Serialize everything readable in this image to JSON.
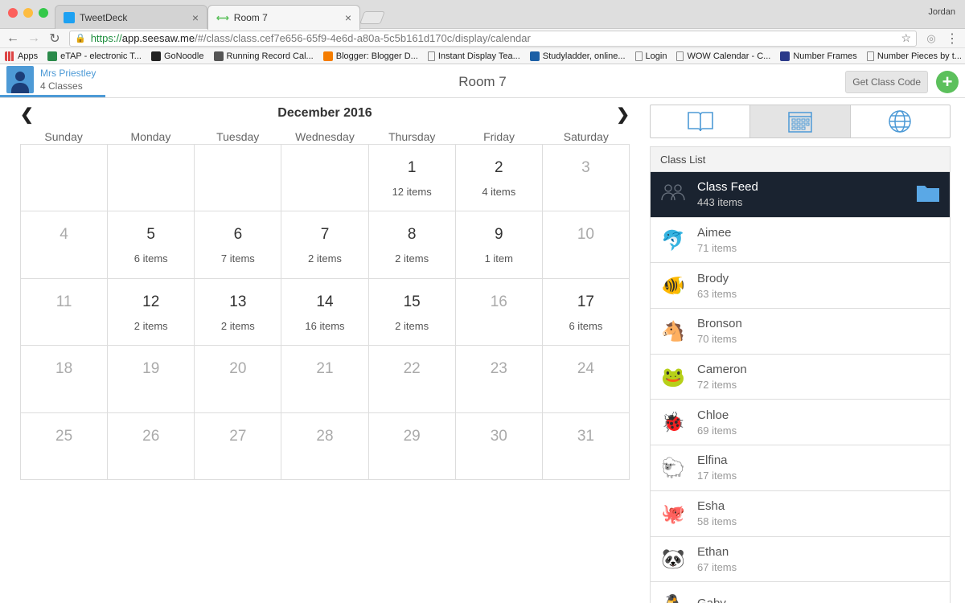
{
  "browser": {
    "tabs": [
      {
        "label": "TweetDeck",
        "close": "×"
      },
      {
        "label": "Room 7",
        "close": "×"
      }
    ],
    "user": "Jordan",
    "url": {
      "scheme": "https://",
      "host": "app.seesaw.me",
      "path": "/#/class/class.cef7e656-65f9-4e6d-a80a-5c5b161d170c/display/calendar"
    },
    "bookmarks": [
      {
        "label": "Apps",
        "icon": "apps-grid-icon",
        "color": "#d44"
      },
      {
        "label": "eTAP - electronic T...",
        "icon": "etap-icon",
        "color": "#2a8a4a"
      },
      {
        "label": "GoNoodle",
        "icon": "gonoodle-icon",
        "color": "#222"
      },
      {
        "label": "Running Record Cal...",
        "icon": "word-icon",
        "color": "#555"
      },
      {
        "label": "Blogger: Blogger D...",
        "icon": "blogger-icon",
        "color": "#f57d00"
      },
      {
        "label": "Instant Display Tea...",
        "icon": "page-icon",
        "color": "#888"
      },
      {
        "label": "Studyladder, online...",
        "icon": "studyladder-icon",
        "color": "#1b5fa6"
      },
      {
        "label": "Login",
        "icon": "page-icon",
        "color": "#888"
      },
      {
        "label": "WOW Calendar - C...",
        "icon": "page-icon",
        "color": "#888"
      },
      {
        "label": "Number Frames",
        "icon": "number-frames-icon",
        "color": "#2b3a8a"
      },
      {
        "label": "Number Pieces by t...",
        "icon": "page-icon",
        "color": "#888"
      }
    ]
  },
  "header": {
    "teacher_name": "Mrs Priestley",
    "teacher_classes": "4 Classes",
    "room_title": "Room 7",
    "class_code_label": "Get Class Code",
    "add_label": "+"
  },
  "calendar": {
    "month_label": "December 2016",
    "weekdays": [
      "Sunday",
      "Monday",
      "Tuesday",
      "Wednesday",
      "Thursday",
      "Friday",
      "Saturday"
    ],
    "cells": [
      {
        "day": "",
        "items": ""
      },
      {
        "day": "",
        "items": ""
      },
      {
        "day": "",
        "items": ""
      },
      {
        "day": "",
        "items": ""
      },
      {
        "day": "1",
        "items": "12 items"
      },
      {
        "day": "2",
        "items": "4 items"
      },
      {
        "day": "3",
        "items": ""
      },
      {
        "day": "4",
        "items": ""
      },
      {
        "day": "5",
        "items": "6 items"
      },
      {
        "day": "6",
        "items": "7 items"
      },
      {
        "day": "7",
        "items": "2 items"
      },
      {
        "day": "8",
        "items": "2 items"
      },
      {
        "day": "9",
        "items": "1 item"
      },
      {
        "day": "10",
        "items": ""
      },
      {
        "day": "11",
        "items": ""
      },
      {
        "day": "12",
        "items": "2 items"
      },
      {
        "day": "13",
        "items": "2 items"
      },
      {
        "day": "14",
        "items": "16 items"
      },
      {
        "day": "15",
        "items": "2 items"
      },
      {
        "day": "16",
        "items": ""
      },
      {
        "day": "17",
        "items": "6 items"
      },
      {
        "day": "18",
        "items": ""
      },
      {
        "day": "19",
        "items": ""
      },
      {
        "day": "20",
        "items": ""
      },
      {
        "day": "21",
        "items": ""
      },
      {
        "day": "22",
        "items": ""
      },
      {
        "day": "23",
        "items": ""
      },
      {
        "day": "24",
        "items": ""
      },
      {
        "day": "25",
        "items": ""
      },
      {
        "day": "26",
        "items": ""
      },
      {
        "day": "27",
        "items": ""
      },
      {
        "day": "28",
        "items": ""
      },
      {
        "day": "29",
        "items": ""
      },
      {
        "day": "30",
        "items": ""
      },
      {
        "day": "31",
        "items": ""
      }
    ]
  },
  "sidebar": {
    "views": [
      "journal-book-icon",
      "calendar-icon",
      "globe-icon"
    ],
    "active_view": 1,
    "class_list_title": "Class List",
    "students": [
      {
        "name": "Class Feed",
        "count": "443 items",
        "icon": "group-icon",
        "emoji": "",
        "feed": true
      },
      {
        "name": "Aimee",
        "count": "71 items",
        "icon": "dolphin-icon",
        "emoji": "🐬"
      },
      {
        "name": "Brody",
        "count": "63 items",
        "icon": "tropical-fish-icon",
        "emoji": "🐠"
      },
      {
        "name": "Bronson",
        "count": "70 items",
        "icon": "horse-icon",
        "emoji": "🐴"
      },
      {
        "name": "Cameron",
        "count": "72 items",
        "icon": "frog-icon",
        "emoji": "🐸"
      },
      {
        "name": "Chloe",
        "count": "69 items",
        "icon": "ladybug-icon",
        "emoji": "🐞"
      },
      {
        "name": "Elfina",
        "count": "17 items",
        "icon": "sheep-icon",
        "emoji": "🐑"
      },
      {
        "name": "Esha",
        "count": "58 items",
        "icon": "octopus-icon",
        "emoji": "🐙"
      },
      {
        "name": "Ethan",
        "count": "67 items",
        "icon": "panda-icon",
        "emoji": "🐼"
      },
      {
        "name": "Gaby",
        "count": "",
        "icon": "penguin-icon",
        "emoji": "🐧"
      }
    ]
  }
}
